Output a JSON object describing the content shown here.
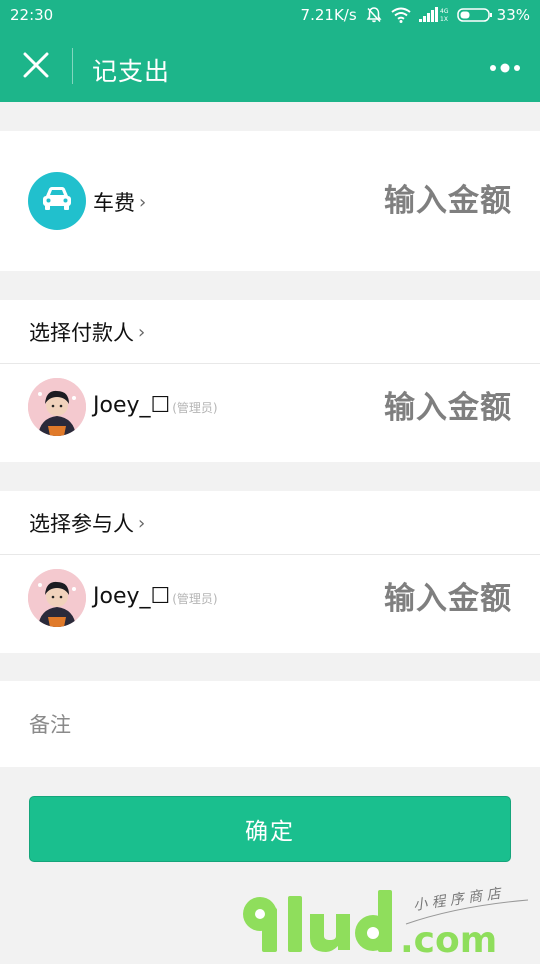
{
  "status_bar": {
    "time": "22:30",
    "net_speed": "7.21K/s",
    "battery": "33%",
    "network_top": "4G",
    "network_bottom": "1X"
  },
  "nav": {
    "title": "记支出"
  },
  "category": {
    "label": "车费",
    "amount_placeholder": "输入金额",
    "icon": "car-icon",
    "icon_color": "#21c0cd"
  },
  "payer": {
    "select_label": "选择付款人",
    "person": {
      "name": "Joey_☐",
      "role": "(管理员)",
      "amount_placeholder": "输入金额"
    }
  },
  "participant": {
    "select_label": "选择参与人",
    "person": {
      "name": "Joey_☐",
      "role": "(管理员)",
      "amount_placeholder": "输入金额"
    }
  },
  "remark": {
    "placeholder": "备注"
  },
  "confirm": {
    "label": "确定"
  },
  "colors": {
    "header": "#1db58a",
    "button": "#1abf8e"
  },
  "watermark": {
    "brand": "91ud",
    "domain": ".com",
    "tagline": "小程序商店"
  }
}
